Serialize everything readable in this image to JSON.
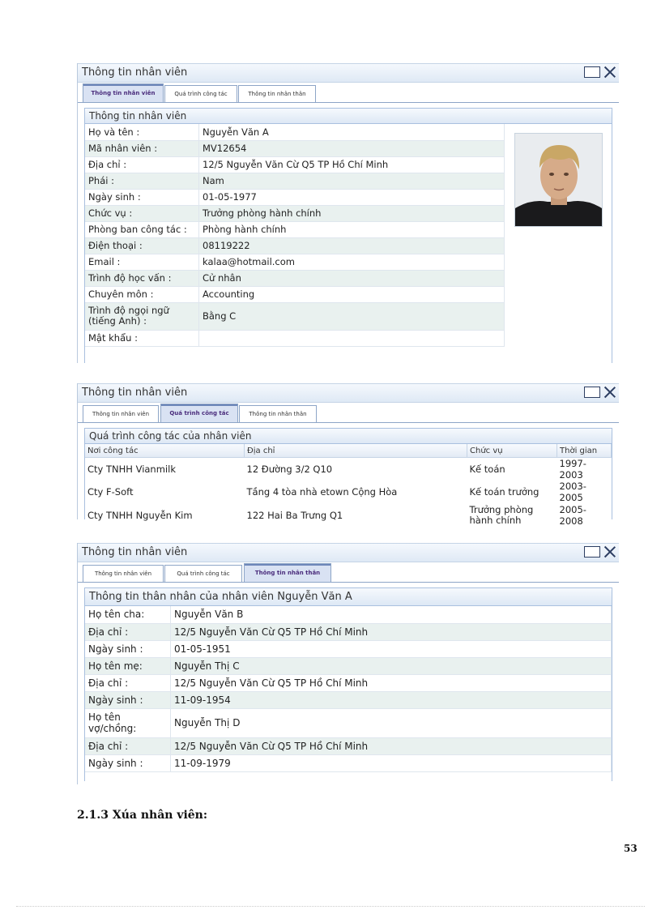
{
  "window1": {
    "title": "Thông tin nhân viên",
    "tabs": [
      "Thông tin nhân viên",
      "Quá trình công tác",
      "Thông tin nhân thân"
    ],
    "panel_title": "Thông tin nhân viên",
    "rows": [
      {
        "label": "Họ và tên :",
        "value": "Nguyễn Văn A"
      },
      {
        "label": "Mã nhân viên :",
        "value": "MV12654"
      },
      {
        "label": "Địa chỉ :",
        "value": "12/5 Nguyễn Văn Cừ Q5 TP Hồ Chí Minh"
      },
      {
        "label": "Phái :",
        "value": "Nam"
      },
      {
        "label": "Ngày sinh :",
        "value": "01-05-1977"
      },
      {
        "label": "Chức vụ :",
        "value": "Trưởng phòng hành chính"
      },
      {
        "label": "Phòng ban công tác :",
        "value": "Phòng hành chính"
      },
      {
        "label": "Điện thoại :",
        "value": "08119222"
      },
      {
        "label": "Email :",
        "value": "kalaa@hotmail.com"
      },
      {
        "label": "Trình độ học vấn :",
        "value": "Cử nhân"
      },
      {
        "label": "Chuyên môn :",
        "value": "Accounting"
      },
      {
        "label": "Trình độ ngọi ngữ (tiếng Anh) :",
        "value": "Bằng C"
      },
      {
        "label": "Mật khẩu :",
        "value": ""
      }
    ]
  },
  "window2": {
    "title": "Thông tin nhân viên",
    "tabs": [
      "Thông tin nhân viên",
      "Quá trình công tác",
      "Thông tin nhân thân"
    ],
    "panel_title": "Quá trình công tác của nhân viên",
    "columns": [
      "Nơi công tác",
      "Địa chỉ",
      "Chức vụ",
      "Thời gian"
    ],
    "rows": [
      [
        "Cty TNHH Vianmilk",
        "12 Đường 3/2 Q10",
        "Kế toán",
        "1997-2003"
      ],
      [
        "Cty F-Soft",
        "Tầng 4 tòa nhà etown Cộng Hòa",
        "Kế toán trưởng",
        "2003-2005"
      ],
      [
        "Cty TNHH Nguyễn Kim",
        "122 Hai Ba Trưng Q1",
        "Trưởng phòng hành chính",
        "2005-2008"
      ]
    ]
  },
  "window3": {
    "title": "Thông tin nhân viên",
    "tabs": [
      "Thông tin nhân viên",
      "Quá trình công tác",
      "Thông tin nhân thân"
    ],
    "panel_title": "Thông tin thân nhân của nhân viên Nguyễn Văn A",
    "rows": [
      {
        "label": "Họ tên cha:",
        "value": "Nguyễn Văn B"
      },
      {
        "label": "Địa chỉ :",
        "value": "12/5 Nguyễn Văn Cừ Q5 TP Hồ Chí Minh"
      },
      {
        "label": "Ngày sinh :",
        "value": "01-05-1951"
      },
      {
        "label": "Họ tên mẹ:",
        "value": "Nguyễn Thị C"
      },
      {
        "label": "Địa chỉ :",
        "value": "12/5 Nguyễn Văn Cừ Q5 TP Hồ Chí Minh"
      },
      {
        "label": "Ngày sinh :",
        "value": "11-09-1954"
      },
      {
        "label": "Họ tên vợ/chồng:",
        "value": "Nguyễn Thị D"
      },
      {
        "label": "Địa chỉ :",
        "value": "12/5 Nguyễn Văn Cừ Q5 TP Hồ Chí Minh"
      },
      {
        "label": "Ngày sinh :",
        "value": "11-09-1979"
      }
    ]
  },
  "document": {
    "heading": "2.1.3 Xúa nhân viên:",
    "page_number": "53"
  }
}
